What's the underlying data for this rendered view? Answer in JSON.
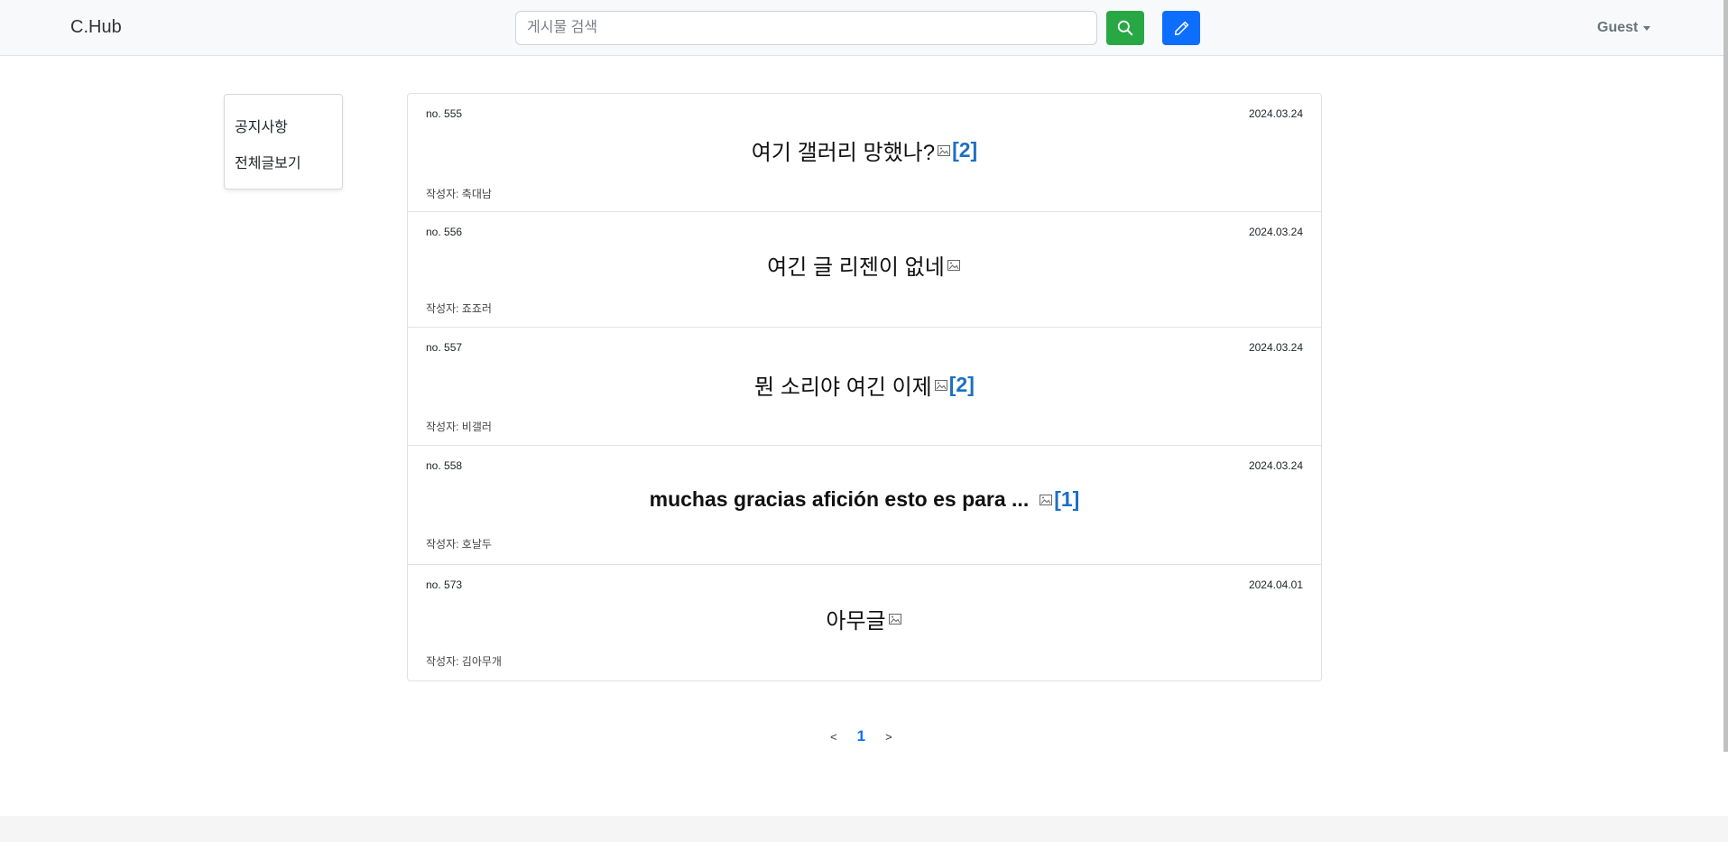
{
  "navbar": {
    "brand": "C.Hub",
    "search_placeholder": "게시물 검색",
    "user_menu_label": "Guest",
    "accent_search": "#28a745",
    "accent_write": "#0d6efd"
  },
  "sidebar": {
    "items": [
      {
        "label": "공지사항"
      },
      {
        "label": "전체글보기"
      }
    ]
  },
  "posts": [
    {
      "no": "no. 555",
      "date": "2024.03.24",
      "title": "여기 갤러리 망했나?",
      "comments": "[2]",
      "author": "작성자: 축대남"
    },
    {
      "no": "no. 556",
      "date": "2024.03.24",
      "title": "여긴 글 리젠이 없네",
      "comments": "",
      "author": "작성자: 죠죠러"
    },
    {
      "no": "no. 557",
      "date": "2024.03.24",
      "title": "뭔 소리야 여긴 이제",
      "comments": "[2]",
      "author": "작성자: 비갤러"
    },
    {
      "no": "no. 558",
      "date": "2024.03.24",
      "title": "muchas gracias afición esto es para ...",
      "comments": "[1]",
      "author": "작성자: 호날두"
    },
    {
      "no": "no. 573",
      "date": "2024.04.01",
      "title": "아무글",
      "comments": "",
      "author": "작성자: 김아무개"
    }
  ],
  "pagination": {
    "prev": "<",
    "current": "1",
    "next": ">"
  }
}
